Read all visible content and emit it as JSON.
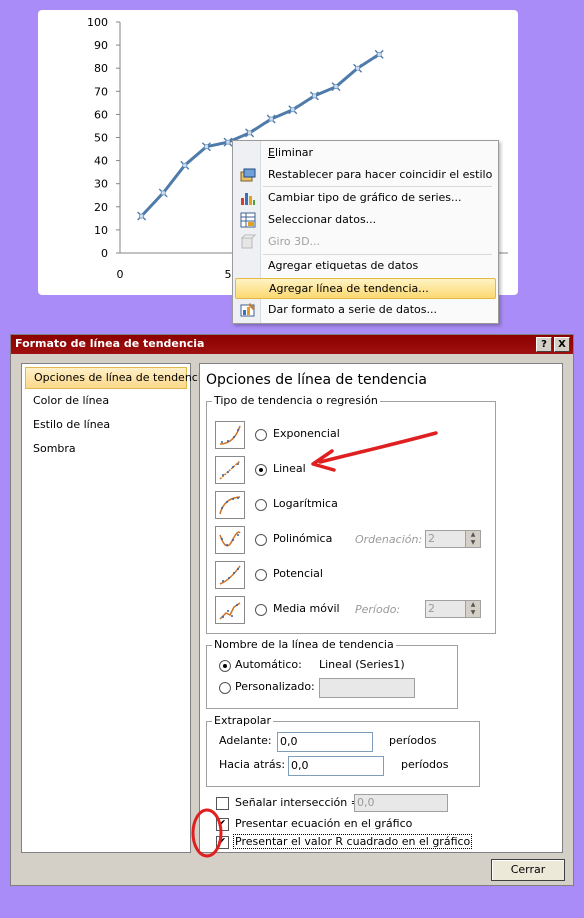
{
  "chart_data": {
    "type": "line",
    "x": [
      1,
      2,
      3,
      4,
      5,
      6,
      7,
      8,
      9,
      10,
      11,
      12
    ],
    "y": [
      16,
      26,
      38,
      46,
      48,
      52,
      58,
      62,
      68,
      72,
      80,
      86
    ],
    "title": "",
    "xlabel": "",
    "ylabel": "",
    "ylim": [
      0,
      100
    ],
    "y_ticks": [
      "0",
      "10",
      "20",
      "30",
      "40",
      "50",
      "60",
      "70",
      "80",
      "90",
      "100"
    ],
    "x_ticks_visible": [
      "0",
      "5"
    ],
    "grid": false,
    "series_color": "#4f7bab"
  },
  "context_menu": {
    "items": [
      {
        "label": "Eliminar",
        "icon": "none",
        "disabled": false
      },
      {
        "label": "Restablecer para hacer coincidir el estilo",
        "icon": "reset-style-icon",
        "disabled": false
      },
      {
        "label": "Cambiar tipo de gráfico de series...",
        "icon": "chart-type-icon",
        "disabled": false
      },
      {
        "label": "Seleccionar datos...",
        "icon": "select-data-icon",
        "disabled": false
      },
      {
        "label": "Giro 3D...",
        "icon": "rotate-3d-icon",
        "disabled": true
      },
      {
        "label": "Agregar etiquetas de datos",
        "icon": "none",
        "disabled": false
      },
      {
        "label": "Agregar línea de tendencia...",
        "icon": "none",
        "disabled": false,
        "highlighted": true
      },
      {
        "label": "Dar formato a serie de datos...",
        "icon": "format-series-icon",
        "disabled": false
      }
    ]
  },
  "dialog": {
    "title": "Formato de línea de tendencia",
    "help_button": "?",
    "close_glyph": "X",
    "nav": [
      "Opciones de línea de tendencia",
      "Color de línea",
      "Estilo de línea",
      "Sombra"
    ],
    "heading": "Opciones de línea de tendencia",
    "type_group": {
      "label": "Tipo de tendencia o regresión",
      "options": [
        "Exponencial",
        "Lineal",
        "Logarítmica",
        "Polinómica",
        "Potencial",
        "Media móvil"
      ],
      "selected": "Lineal",
      "order_label": "Ordenación:",
      "order_value": "2",
      "period_label": "Período:",
      "period_value": "2"
    },
    "name_group": {
      "label": "Nombre de la línea de tendencia",
      "auto_label": "Automático:",
      "auto_value": "Lineal (Series1)",
      "custom_label": "Personalizado:"
    },
    "extrapolate": {
      "label": "Extrapolar",
      "forward_label": "Adelante:",
      "forward_value": "0,0",
      "backward_label": "Hacia atrás:",
      "backward_value": "0,0",
      "unit": "períodos"
    },
    "intercept_label": "Señalar intersección =",
    "intercept_value": "0,0",
    "show_equation_label": "Presentar ecuación en el gráfico",
    "show_r2_label": "Presentar el valor R cuadrado en el gráfico",
    "close_button": "Cerrar"
  },
  "annotations": {
    "arrow_color": "#e02020",
    "circle_color": "#e02020"
  }
}
